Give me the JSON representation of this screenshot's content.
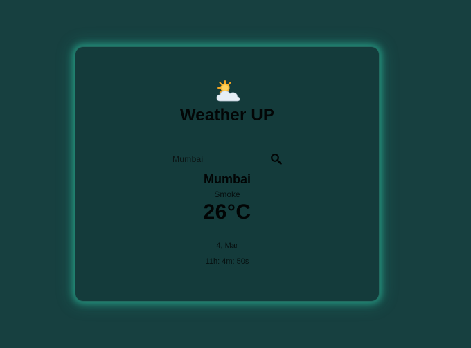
{
  "app": {
    "title": "Weather UP",
    "logo_icon": "sun-behind-cloud-icon"
  },
  "search": {
    "value": "Mumbai",
    "placeholder": "Mumbai",
    "button_icon": "search-icon"
  },
  "weather": {
    "city": "Mumbai",
    "condition": "Smoke",
    "temperature": "26°C",
    "date": "4, Mar",
    "time": "11h: 4m: 50s"
  },
  "colors": {
    "background": "#174040",
    "card": "#143b3b",
    "glow": "#2dc8a5",
    "text": "#030606"
  }
}
